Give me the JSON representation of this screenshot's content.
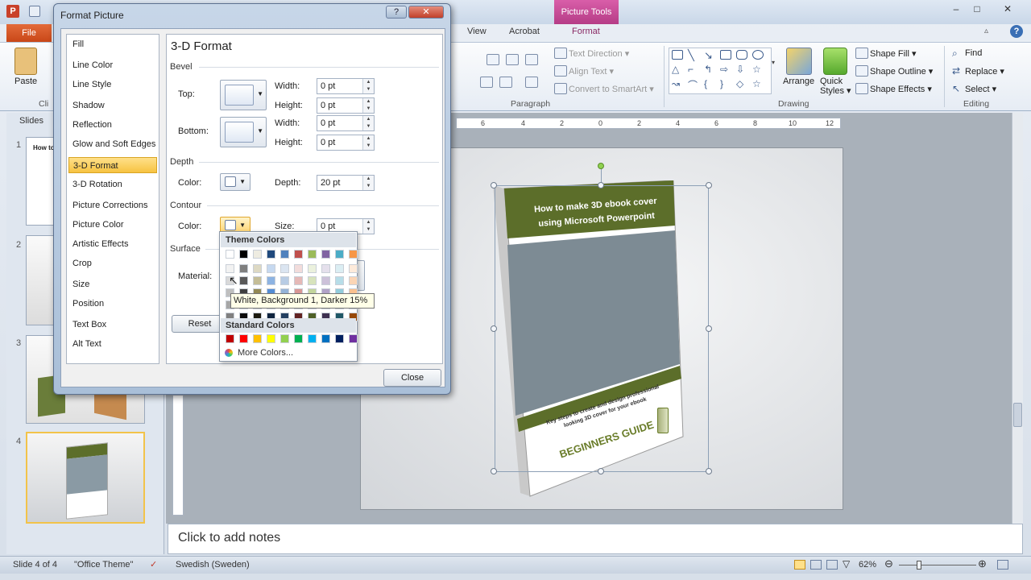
{
  "colors": {
    "accent": "#c94718",
    "context_tab": "#b53c86",
    "book_green": "#5c6e2a",
    "selected_nav": "#f7c342"
  },
  "titlebar": {
    "context_tab": "Picture Tools",
    "min": "–",
    "max": "□",
    "close": "✕"
  },
  "tabs": {
    "file": "File",
    "view": "View",
    "acrobat": "Acrobat",
    "format": "Format"
  },
  "ribbon": {
    "clipboard": {
      "paste": "Paste",
      "group": "Cli"
    },
    "paragraph": {
      "text_direction": "Text Direction ▾",
      "align_text": "Align Text ▾",
      "convert": "Convert to SmartArt ▾",
      "group": "Paragraph"
    },
    "drawing": {
      "arrange": "Arrange",
      "quick_styles": "Quick Styles ▾",
      "shape_fill": "Shape Fill ▾",
      "shape_outline": "Shape Outline ▾",
      "shape_effects": "Shape Effects ▾",
      "group": "Drawing"
    },
    "editing": {
      "find": "Find",
      "replace": "Replace ▾",
      "select": "Select ▾",
      "group": "Editing"
    }
  },
  "slides_panel": {
    "header": "Slides",
    "numbers": [
      "1",
      "2",
      "3",
      "4"
    ],
    "thumb1_title": "How to"
  },
  "ruler": {
    "marks": [
      "6",
      "4",
      "2",
      "0",
      "2",
      "4",
      "6",
      "8",
      "10",
      "12"
    ]
  },
  "dialog": {
    "title": "Format Picture",
    "help": "?",
    "close_x": "✕",
    "nav": [
      "Fill",
      "Line Color",
      "Line Style",
      "Shadow",
      "Reflection",
      "Glow and Soft Edges",
      "3-D Format",
      "3-D Rotation",
      "Picture Corrections",
      "Picture Color",
      "Artistic Effects",
      "Crop",
      "Size",
      "Position",
      "Text Box",
      "Alt Text"
    ],
    "selected_nav": "3-D Format",
    "panel_title": "3-D Format",
    "bevel": {
      "section": "Bevel",
      "top": "Top:",
      "bottom": "Bottom:",
      "width": "Width:",
      "height": "Height:",
      "top_width": "0 pt",
      "top_height": "0 pt",
      "bottom_width": "0 pt",
      "bottom_height": "0 pt"
    },
    "depth": {
      "section": "Depth",
      "color": "Color:",
      "depth_label": "Depth:",
      "depth_value": "20 pt"
    },
    "contour": {
      "section": "Contour",
      "color": "Color:",
      "size_label": "Size:",
      "size_value": "0 pt"
    },
    "surface": {
      "section": "Surface",
      "material": "Material:"
    },
    "reset": "Reset",
    "close_button": "Close"
  },
  "color_popup": {
    "theme_header": "Theme Colors",
    "standard_header": "Standard Colors",
    "more_colors": "More Colors...",
    "theme_row": [
      "#ffffff",
      "#000000",
      "#eeece1",
      "#1f497d",
      "#4f81bd",
      "#c0504d",
      "#9bbb59",
      "#8064a2",
      "#4bacc6",
      "#f79646"
    ],
    "shade_cols": [
      [
        "#f2f2f2",
        "#d9d9d9",
        "#bfbfbf",
        "#a6a6a6",
        "#808080"
      ],
      [
        "#7f7f7f",
        "#595959",
        "#3f3f3f",
        "#262626",
        "#0c0c0c"
      ],
      [
        "#ddd9c3",
        "#c4bd97",
        "#938953",
        "#494429",
        "#1d1b10"
      ],
      [
        "#c6d9f0",
        "#8db3e2",
        "#548dd4",
        "#17365d",
        "#0f243e"
      ],
      [
        "#dbe5f1",
        "#b8cce4",
        "#95b3d7",
        "#366092",
        "#244061"
      ],
      [
        "#f2dcdb",
        "#e5b9b7",
        "#d99694",
        "#953734",
        "#632423"
      ],
      [
        "#ebf1dd",
        "#d7e3bc",
        "#c3d69b",
        "#76923c",
        "#4f6128"
      ],
      [
        "#e5e0ec",
        "#ccc1d9",
        "#b2a2c7",
        "#5f497a",
        "#3f3151"
      ],
      [
        "#dbeef3",
        "#b7dde8",
        "#92cddc",
        "#31859b",
        "#205867"
      ],
      [
        "#fdeada",
        "#fbd5b5",
        "#fac08f",
        "#e36c09",
        "#974806"
      ]
    ],
    "standard_row": [
      "#c00000",
      "#ff0000",
      "#ffc000",
      "#ffff00",
      "#92d050",
      "#00b050",
      "#00b0f0",
      "#0070c0",
      "#002060",
      "#7030a0"
    ],
    "tooltip": "White, Background 1, Darker 15%"
  },
  "book": {
    "title_line1": "How to make 3D ebook cover",
    "title_line2": "using Microsoft Powerpoint",
    "subtitle_line1": "Key steps to create and design professional",
    "subtitle_line2": "looking 3D cover for your ebook",
    "brand": "BEGINNERS GUIDE"
  },
  "notes": {
    "placeholder": "Click to add notes"
  },
  "status": {
    "slide": "Slide 4 of 4",
    "theme": "\"Office Theme\"",
    "language": "Swedish (Sweden)",
    "zoom": "62%"
  }
}
